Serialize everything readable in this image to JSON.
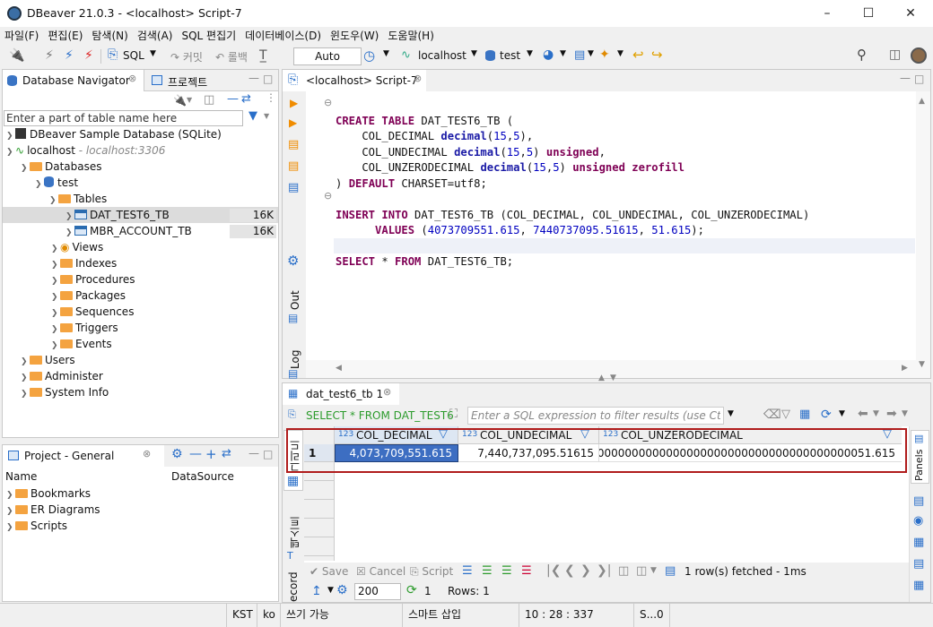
{
  "window": {
    "title": "DBeaver 21.0.3 - <localhost> Script-7"
  },
  "menu": [
    "파일(F)",
    "편집(E)",
    "탐색(N)",
    "검색(A)",
    "SQL 편집기",
    "데이터베이스(D)",
    "윈도우(W)",
    "도움말(H)"
  ],
  "toolbar": {
    "sql": "SQL",
    "commit": "커밋",
    "rollback": "롤백",
    "tx_mode": "Auto",
    "connection": "localhost",
    "schema": "test"
  },
  "navigator": {
    "tab1": "Database Navigator",
    "tab2": "프로젝트",
    "filter_placeholder": "Enter a part of table name here",
    "items": {
      "sample": "DBeaver Sample Database (SQLite)",
      "localhost": "localhost",
      "localhost_host": "- localhost:3306",
      "databases": "Databases",
      "test": "test",
      "tables": "Tables",
      "t1": "DAT_TEST6_TB",
      "t1_size": "16K",
      "t2": "MBR_ACCOUNT_TB",
      "t2_size": "16K",
      "views": "Views",
      "indexes": "Indexes",
      "procedures": "Procedures",
      "packages": "Packages",
      "sequences": "Sequences",
      "triggers": "Triggers",
      "events": "Events",
      "users": "Users",
      "administer": "Administer",
      "sysinfo": "System Info"
    }
  },
  "project": {
    "tab": "Project - General",
    "col_name": "Name",
    "col_ds": "DataSource",
    "items": [
      "Bookmarks",
      "ER Diagrams",
      "Scripts"
    ]
  },
  "editor": {
    "tab": "<localhost> Script-7",
    "side_out": "Out",
    "side_log": "Log",
    "lines": {
      "l1a": "CREATE TABLE",
      "l1b": " DAT_TEST6_TB (",
      "l2a": "    COL_DECIMAL ",
      "l2b": "decimal",
      "l2c": "(",
      "l2d": "15",
      "l2e": ",",
      "l2f": "5",
      "l2g": "),",
      "l3a": "    COL_UNDECIMAL ",
      "l3b": "decimal",
      "l3c": "(",
      "l3d": "15",
      "l3e": ",",
      "l3f": "5",
      "l3g": ") ",
      "l3h": "unsigned",
      ",": ",",
      "l4a": "    COL_UNZERODECIMAL ",
      "l4b": "decimal",
      "l4c": "(",
      "l4d": "15",
      "l4e": ",",
      "l4f": "5",
      "l4g": ") ",
      "l4h": "unsigned zerofill",
      "l5a": ") ",
      "l5b": "DEFAULT",
      "l5c": " CHARSET=utf8;",
      "l6a": "INSERT INTO",
      "l6b": " DAT_TEST6_TB (COL_DECIMAL, COL_UNDECIMAL, COL_UNZERODECIMAL)",
      "l7a": "      VALUES",
      "l7b": " (",
      "l7c": "4073709551.615",
      ", ": ", ",
      "l7d": "7440737095.51615",
      "l7e": ", ",
      "l7f": "51.615",
      "l7g": ");",
      "l8a": "SELECT",
      "l8b": " * ",
      "l8c": "FROM",
      "l8d": " DAT_TEST6_TB;"
    }
  },
  "results": {
    "tab": "dat_test6_tb 1",
    "query": "SELECT * FROM DAT_TEST6",
    "filter_placeholder": "Enter a SQL expression to filter results (use Ctrl+S",
    "side_grid": "그리드",
    "side_text": "텍스트",
    "side_record": "ecord",
    "panels": "Panels",
    "columns": [
      "COL_DECIMAL",
      "COL_UNDECIMAL",
      "COL_UNZERODECIMAL"
    ],
    "type_tag": "123",
    "row_num": "1",
    "values": [
      "4,073,709,551.615",
      "7,440,737,095.51615",
      "0000000000000000000000000000000000000000000000051.615"
    ],
    "save": "Save",
    "cancel": "Cancel",
    "script": "Script",
    "fetched": "1 row(s) fetched - 1ms",
    "limit": "200",
    "count": "1",
    "rows": "Rows: 1"
  },
  "status": {
    "tz": "KST",
    "lang": "ko",
    "write": "쓰기 가능",
    "insert": "스마트 삽입",
    "pos": "10 : 28 : 337",
    "extra": "S...0"
  }
}
